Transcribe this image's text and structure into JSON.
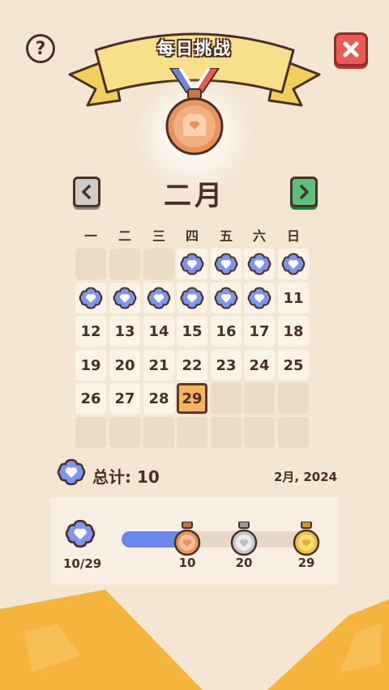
{
  "header": {
    "title": "每日挑战",
    "help_label": "?",
    "close_label": "✕"
  },
  "calendar": {
    "month": "二月",
    "weekdays": [
      "一",
      "二",
      "三",
      "四",
      "五",
      "六",
      "日"
    ],
    "completed_days": 10,
    "today": "29"
  },
  "summary": {
    "total_label": "总计: 10",
    "date_label": "2月, 2024"
  },
  "progress": {
    "count_label": "10/29",
    "milestones": [
      "10",
      "20",
      "29"
    ],
    "fill_color": "#6b86e6"
  },
  "colors": {
    "background": "#f3e6d3",
    "ribbon": "#f8e08a",
    "close": "#e85c55",
    "next": "#5dc07a",
    "today": "#f7b35e",
    "badge": "#7d95ec",
    "medal_bronze": "#e8925c",
    "medal_silver": "#c9c9c9",
    "medal_gold": "#f1c23a"
  }
}
